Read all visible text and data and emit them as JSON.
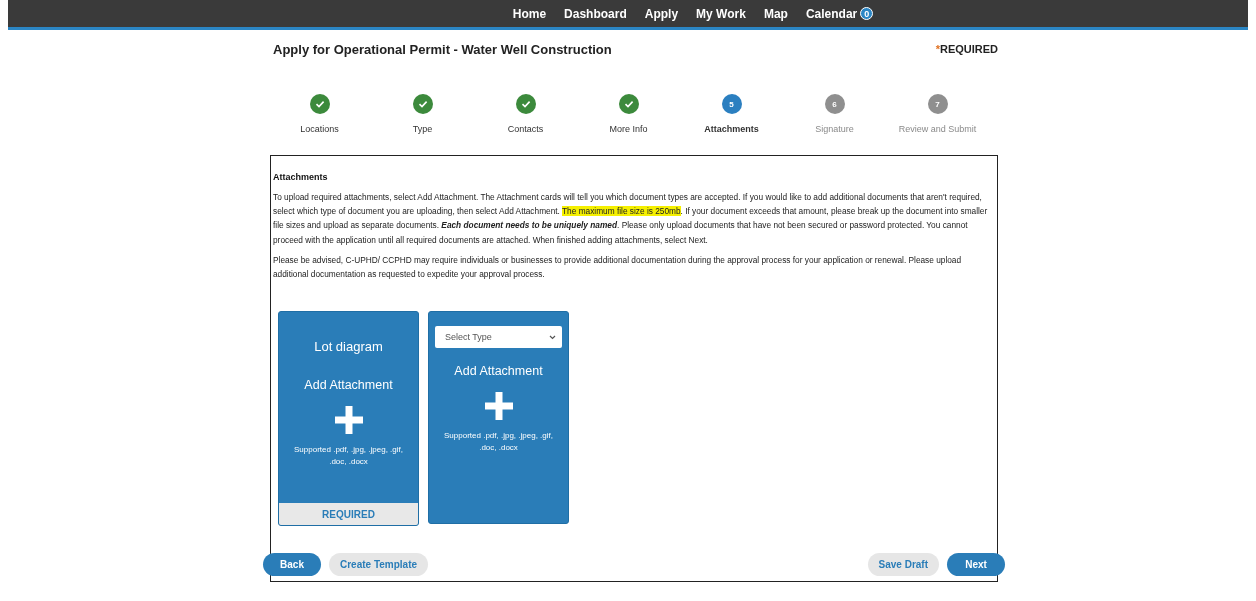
{
  "nav": {
    "items": [
      {
        "label": "Home"
      },
      {
        "label": "Dashboard"
      },
      {
        "label": "Apply"
      },
      {
        "label": "My Work"
      },
      {
        "label": "Map"
      },
      {
        "label": "Calendar",
        "badge": "0"
      }
    ]
  },
  "page": {
    "title": "Apply for Operational Permit - Water Well Construction",
    "required_mark": "*",
    "required_label": "REQUIRED"
  },
  "steps": [
    {
      "label": "Locations",
      "kind": "done"
    },
    {
      "label": "Type",
      "kind": "done"
    },
    {
      "label": "Contacts",
      "kind": "done"
    },
    {
      "label": "More Info",
      "kind": "done"
    },
    {
      "label": "Attachments",
      "kind": "current",
      "number": "5"
    },
    {
      "label": "Signature",
      "kind": "pending",
      "number": "6"
    },
    {
      "label": "Review and Submit",
      "kind": "pending",
      "number": "7"
    }
  ],
  "section": {
    "heading": "Attachments",
    "paragraphs": [
      [
        {
          "kind": "plain",
          "text": "To upload required attachments, select Add Attachment. The Attachment cards will tell you which document types are accepted. If you would like to add additional documents that aren't required, select which type of document you are uploading, then select Add Attachment. "
        },
        {
          "kind": "highlight",
          "text": "The maximum file size is 250mb"
        },
        {
          "kind": "plain",
          "text": ". If your document exceeds that amount, please break up the document into smaller file sizes and upload as separate documents. "
        },
        {
          "kind": "emphasis",
          "text": "Each document needs to be uniquely named"
        },
        {
          "kind": "plain",
          "text": ". Please only upload documents that have not been secured or password protected. You cannot proceed with the application until all required documents are attached. When finished adding attachments, select Next."
        }
      ],
      [
        {
          "kind": "plain",
          "text": "Please be advised, C-UPHD/ CCPHD may require individuals or businesses to provide additional documentation during the approval process for your application or renewal. Please upload additional documentation as requested to expedite your approval process."
        }
      ]
    ]
  },
  "cards": [
    {
      "kind": "required",
      "title": "Lot diagram",
      "action": "Add Attachment",
      "supported": "Supported .pdf, .jpg, .jpeg, .gif, .doc, .docx",
      "footer": "REQUIRED"
    },
    {
      "kind": "optional",
      "select_placeholder": "Select Type",
      "action": "Add Attachment",
      "supported": "Supported .pdf, .jpg, .jpeg, .gif, .doc, .docx"
    }
  ],
  "footer_buttons": [
    {
      "label": "Back",
      "kind": "primary"
    },
    {
      "label": "Create Template",
      "kind": "secondary"
    },
    {
      "label": "Save Draft",
      "kind": "secondary"
    },
    {
      "label": "Next",
      "kind": "primary"
    }
  ]
}
